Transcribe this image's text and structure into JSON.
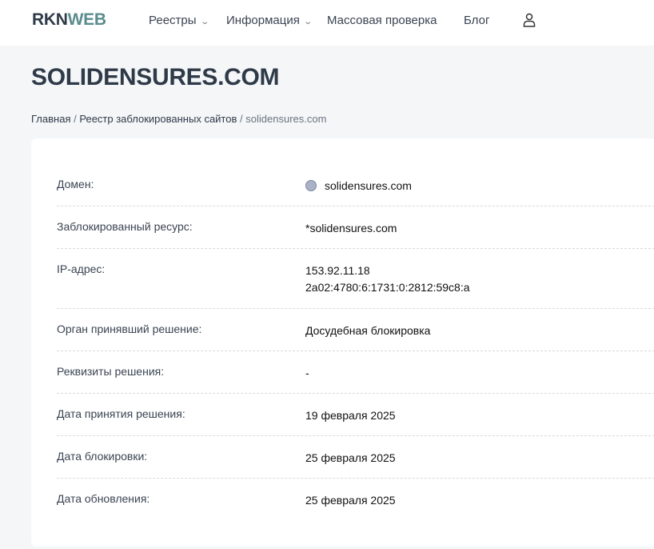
{
  "header": {
    "logo_a": "RKN",
    "logo_b": "WEB",
    "nav": [
      {
        "label": "Реестры",
        "dropdown": true
      },
      {
        "label": "Информация",
        "dropdown": true
      },
      {
        "label": "Массовая проверка"
      },
      {
        "label": "Блог"
      }
    ]
  },
  "title": "SOLIDENSURES.COM",
  "breadcrumb": {
    "home": "Главная",
    "sep": "/",
    "registry": "Реестр заблокированных сайтов",
    "current": "solidensures.com"
  },
  "rows": [
    {
      "label": "Домен:",
      "value": "solidensures.com"
    },
    {
      "label": "Заблокированный ресурс:",
      "value": "*solidensures.com"
    },
    {
      "label": "IP-адрес:",
      "value": "153.92.11.18",
      "value2": "2a02:4780:6:1731:0:2812:59c8:a"
    },
    {
      "label": "Орган принявший решение:",
      "value": "Досудебная блокировка"
    },
    {
      "label": "Реквизиты решения:",
      "value": "-"
    },
    {
      "label": "Дата принятия решения:",
      "value": "19 февраля 2025"
    },
    {
      "label": "Дата блокировки:",
      "value": "25 февраля 2025"
    },
    {
      "label": "Дата обновления:",
      "value": "25 февраля 2025"
    }
  ]
}
